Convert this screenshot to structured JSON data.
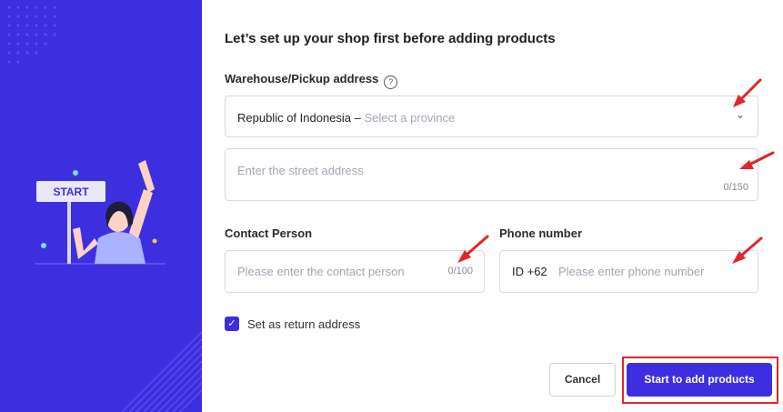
{
  "heading": "Let’s set up your shop first before adding products",
  "illustration": {
    "sign_text": "START"
  },
  "address": {
    "label": "Warehouse/Pickup address",
    "help_icon": "?",
    "country": "Republic of Indonesia –",
    "province_placeholder": "Select a province",
    "street_placeholder": "Enter the street address",
    "street_counter": "0/150"
  },
  "contact": {
    "label": "Contact Person",
    "placeholder": "Please enter the contact person",
    "counter": "0/100"
  },
  "phone": {
    "label": "Phone number",
    "prefix": "ID +62",
    "placeholder": "Please enter phone number"
  },
  "return_address": {
    "label": "Set as return address",
    "checked": true
  },
  "buttons": {
    "cancel": "Cancel",
    "start": "Start to add products"
  },
  "colors": {
    "accent": "#3d2fe0",
    "annotation": "#e0262b"
  },
  "icons": [
    "help-icon",
    "chevron-down-icon",
    "check-icon"
  ]
}
